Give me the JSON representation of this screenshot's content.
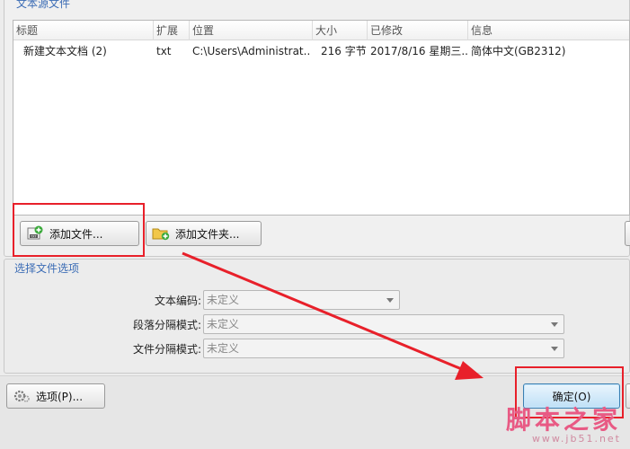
{
  "source_group": {
    "title": "文本源文件"
  },
  "file_list": {
    "columns": [
      "标题",
      "扩展",
      "位置",
      "大小",
      "已修改",
      "信息"
    ],
    "rows": [
      {
        "title": "新建文本文档 (2)",
        "ext": "txt",
        "location": "C:\\Users\\Administrat..",
        "size": "216 字节",
        "modified": "2017/8/16 星期三..",
        "info": "简体中文(GB2312)"
      }
    ]
  },
  "buttons": {
    "add_file": "添加文件...",
    "add_folder": "添加文件夹...",
    "options": "选项(P)...",
    "ok": "确定(O)"
  },
  "options_group": {
    "title": "选择文件选项",
    "text_encoding_label": "文本编码:",
    "text_encoding_value": "未定义",
    "paragraph_mode_label": "段落分隔模式:",
    "paragraph_mode_value": "未定义",
    "file_mode_label": "文件分隔模式:",
    "file_mode_value": "未定义"
  },
  "watermark": {
    "text": "脚本之家",
    "url": "www.jb51.net"
  },
  "colors": {
    "annotation": "#e8202a",
    "accent": "#3b6cb5"
  }
}
